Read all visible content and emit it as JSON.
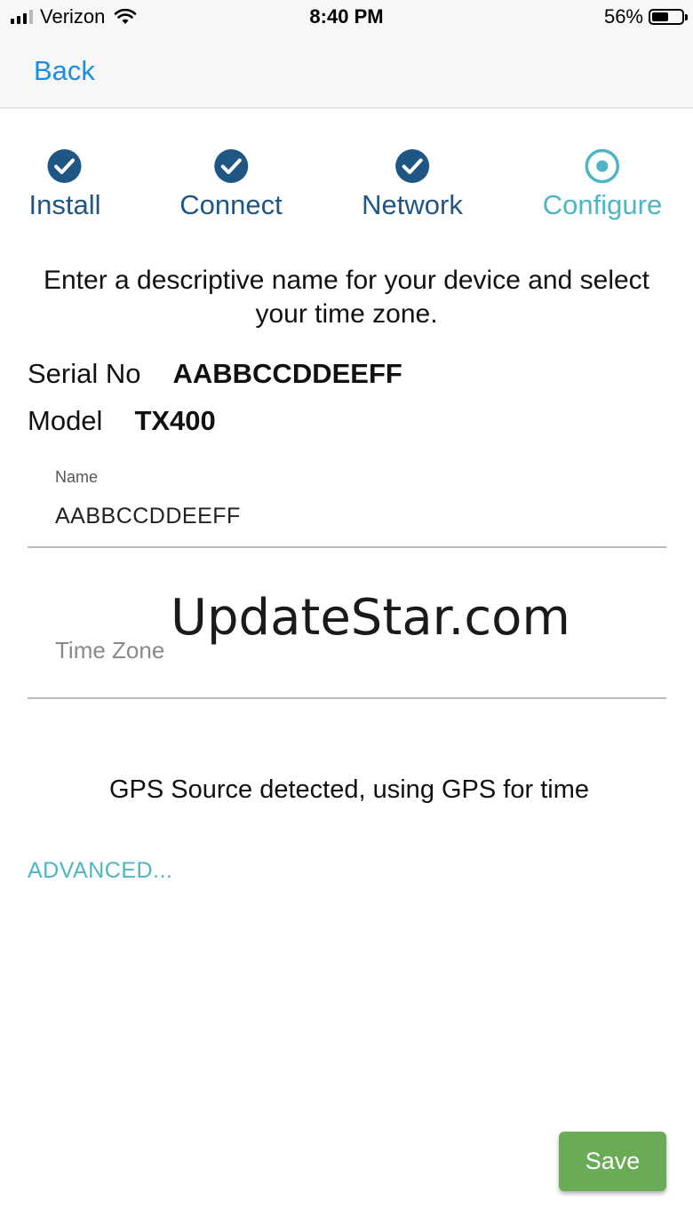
{
  "status_bar": {
    "carrier": "Verizon",
    "time": "8:40 PM",
    "battery": "56%",
    "battery_level": 0.56,
    "signal_bars": 3,
    "signal_bars_total": 4
  },
  "nav": {
    "back_label": "Back"
  },
  "steps": [
    {
      "label": "Install",
      "state": "done",
      "icon": "check-circle-icon"
    },
    {
      "label": "Connect",
      "state": "done",
      "icon": "check-circle-icon"
    },
    {
      "label": "Network",
      "state": "done",
      "icon": "check-circle-icon"
    },
    {
      "label": "Configure",
      "state": "active",
      "icon": "radio-dot-icon"
    }
  ],
  "intro_text": "Enter a descriptive name for your device and select your time zone.",
  "device": {
    "serial_label": "Serial No",
    "serial_value": "AABBCCDDEEFF",
    "model_label": "Model",
    "model_value": "TX400"
  },
  "form": {
    "name_label": "Name",
    "name_value": "AABBCCDDEEFF",
    "timezone_placeholder": "Time Zone"
  },
  "watermark": "UpdateStar.com",
  "gps_message": "GPS Source detected, using GPS for time",
  "advanced_label": "ADVANCED...",
  "save_label": "Save",
  "colors": {
    "link_blue": "#1a8ee0",
    "step_done": "#1f5684",
    "step_active": "#4db5c6",
    "save_green": "#6aac55"
  }
}
